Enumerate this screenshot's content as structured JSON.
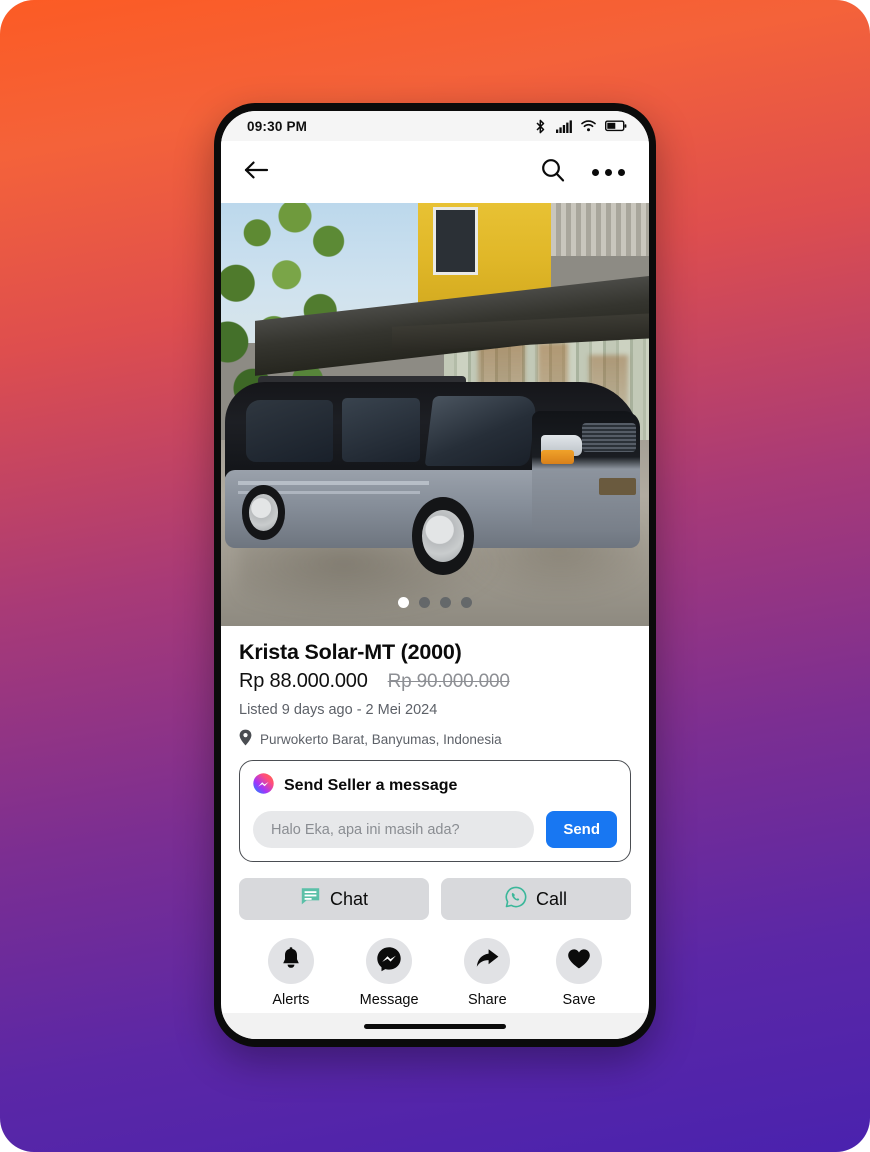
{
  "theme": {
    "accent_blue": "#1877F2",
    "chat_green": "#5BC0A8",
    "gradient_top": "#FC5B24",
    "gradient_bottom": "#4A22AE",
    "button_gray": "#D8D9DC"
  },
  "status_bar": {
    "time": "09:30 PM",
    "icons": [
      "bluetooth-icon",
      "cellular-signal-icon",
      "wifi-icon",
      "battery-icon"
    ]
  },
  "nav_bar": {
    "back": "back-arrow-icon",
    "search": "search-icon",
    "more": "more-options-icon"
  },
  "gallery": {
    "alt": "Black and silver Toyota Kijang Krista parked under a metal canopy",
    "dot_count": 4,
    "active_dot": 1
  },
  "listing": {
    "title": "Krista Solar-MT (2000)",
    "price": "Rp 88.000.000",
    "price_original": "Rp 90.000.000",
    "listed": "Listed 9 days ago - 2 Mei 2024",
    "location": "Purwokerto Barat, Banyumas, Indonesia",
    "location_icon": "location-pin-icon"
  },
  "message_card": {
    "icon": "messenger-icon",
    "heading": "Send Seller a message",
    "input_value": "",
    "input_placeholder": "Halo Eka, apa ini masih ada?",
    "send_label": "Send"
  },
  "cta_buttons": [
    {
      "label": "Chat",
      "icon": "chat-box-icon"
    },
    {
      "label": "Call",
      "icon": "whatsapp-call-icon"
    }
  ],
  "actions": [
    {
      "label": "Alerts",
      "icon": "bell-icon"
    },
    {
      "label": "Message",
      "icon": "messenger-icon"
    },
    {
      "label": "Share",
      "icon": "share-arrow-icon"
    },
    {
      "label": "Save",
      "icon": "heart-icon"
    }
  ]
}
